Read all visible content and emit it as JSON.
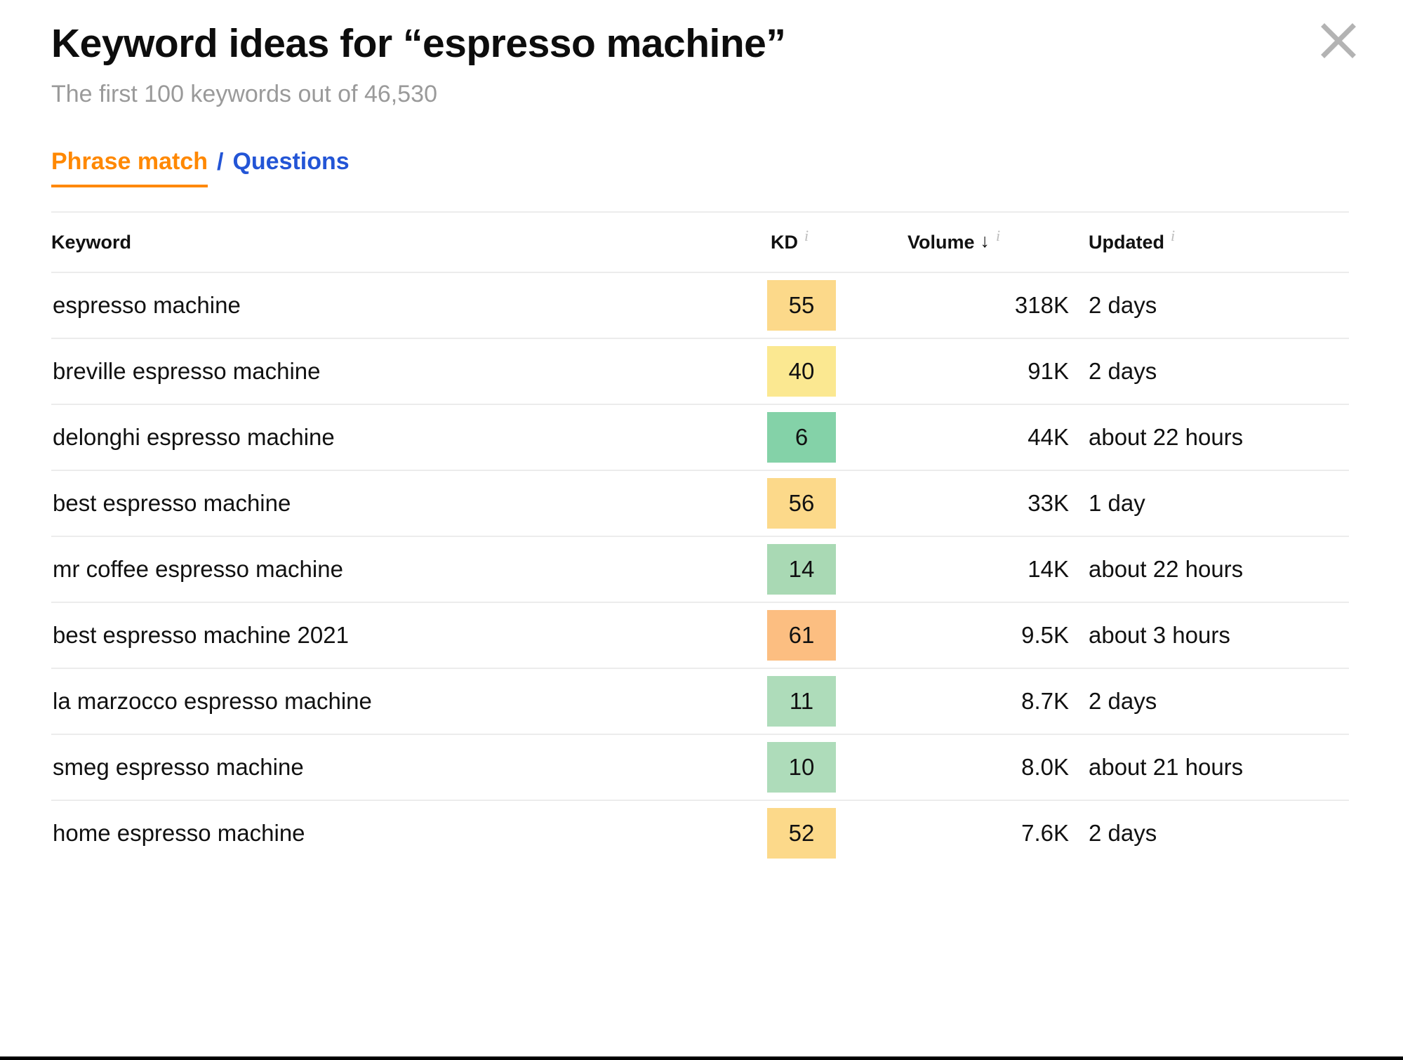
{
  "dialog": {
    "title": "Keyword ideas for “espresso machine”",
    "subtitle": "The first 100 keywords out of 46,530",
    "close_icon": "close-icon"
  },
  "tabs": {
    "separator": "/",
    "items": [
      {
        "label": "Phrase match",
        "active": true,
        "color": "#ff8800"
      },
      {
        "label": "Questions",
        "active": false,
        "color": "#2355d6"
      }
    ]
  },
  "table": {
    "headers": {
      "keyword": "Keyword",
      "kd": "KD",
      "volume": "Volume",
      "volume_sort_arrow": "↓",
      "updated": "Updated",
      "info_icon": "i"
    },
    "rows": [
      {
        "keyword": "espresso machine",
        "kd": "55",
        "kd_color": "#fcd98a",
        "volume": "318K",
        "updated": "2 days"
      },
      {
        "keyword": "breville espresso machine",
        "kd": "40",
        "kd_color": "#fbe891",
        "volume": "91K",
        "updated": "2 days"
      },
      {
        "keyword": "delonghi espresso machine",
        "kd": "6",
        "kd_color": "#84d2a8",
        "volume": "44K",
        "updated": "about 22 hours"
      },
      {
        "keyword": "best espresso machine",
        "kd": "56",
        "kd_color": "#fcd98a",
        "volume": "33K",
        "updated": "1 day"
      },
      {
        "keyword": "mr coffee espresso machine",
        "kd": "14",
        "kd_color": "#a9d9b4",
        "volume": "14K",
        "updated": "about 22 hours"
      },
      {
        "keyword": "best espresso machine 2021",
        "kd": "61",
        "kd_color": "#fcbe81",
        "volume": "9.5K",
        "updated": "about 3 hours"
      },
      {
        "keyword": "la marzocco espresso machine",
        "kd": "11",
        "kd_color": "#aedcba",
        "volume": "8.7K",
        "updated": "2 days"
      },
      {
        "keyword": "smeg espresso machine",
        "kd": "10",
        "kd_color": "#aedcba",
        "volume": "8.0K",
        "updated": "about 21 hours"
      },
      {
        "keyword": "home espresso machine",
        "kd": "52",
        "kd_color": "#fcd98a",
        "volume": "7.6K",
        "updated": "2 days"
      }
    ]
  }
}
